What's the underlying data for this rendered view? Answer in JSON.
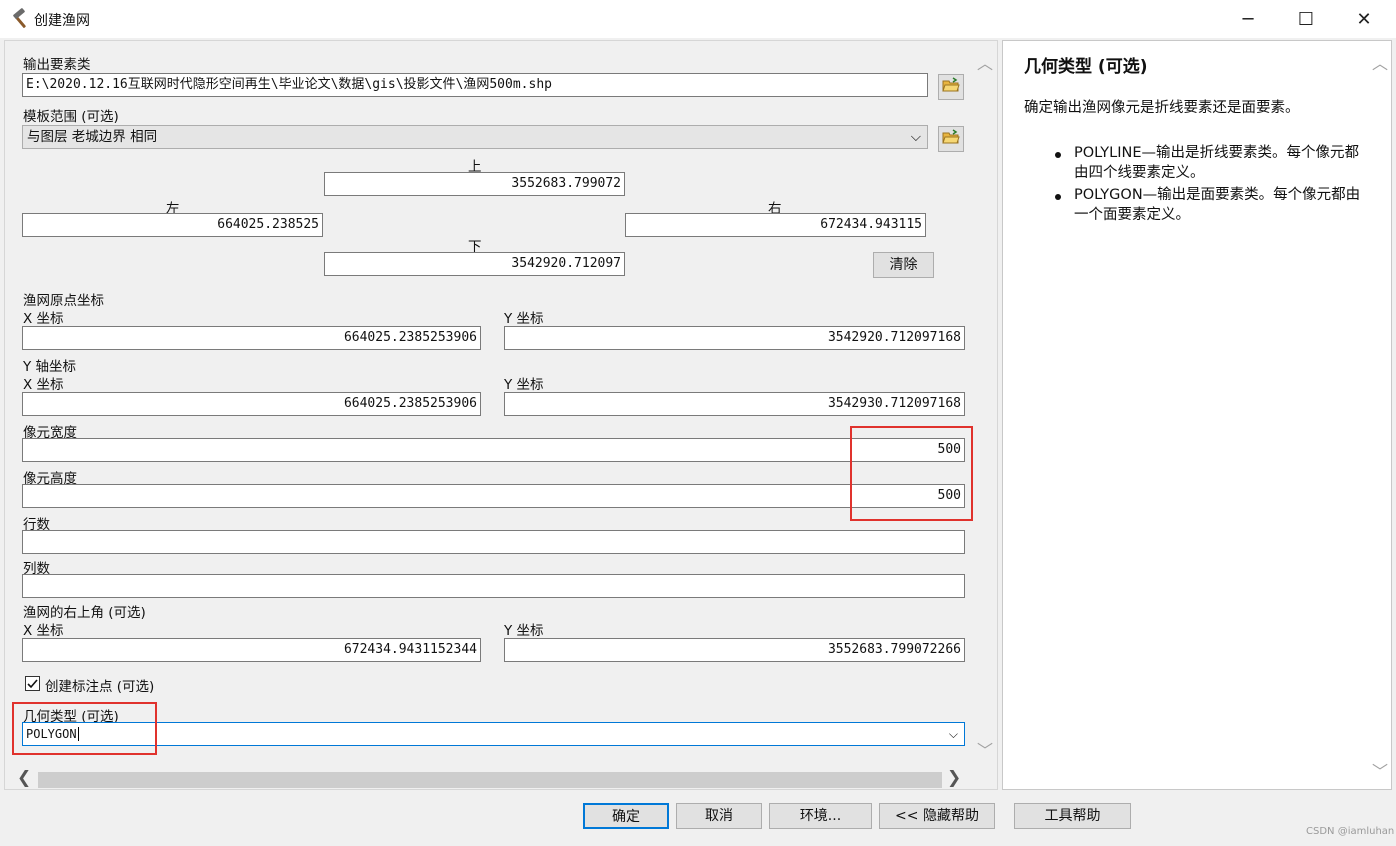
{
  "window": {
    "title": "创建渔网",
    "minimize": "─",
    "maximize": "☐",
    "close": "✕"
  },
  "form": {
    "output_label": "输出要素类",
    "output_value": "E:\\2020.12.16互联网时代隐形空间再生\\毕业论文\\数据\\gis\\投影文件\\渔网500m.shp",
    "template_label": "模板范围 (可选)",
    "template_value": "与图层 老城边界 相同",
    "top_label": "上",
    "top_value": "3552683.799072",
    "left_label": "左",
    "left_value": "664025.238525",
    "right_label": "右",
    "right_value": "672434.943115",
    "bottom_label": "下",
    "bottom_value": "3542920.712097",
    "clear_label": "清除",
    "origin_label": "渔网原点坐标",
    "origin_x_label": "X 坐标",
    "origin_x_value": "664025.2385253906",
    "origin_y_label": "Y 坐标",
    "origin_y_value": "3542920.712097168",
    "yaxis_label": "Y 轴坐标",
    "yaxis_x_label": "X 坐标",
    "yaxis_x_value": "664025.2385253906",
    "yaxis_y_label": "Y 坐标",
    "yaxis_y_value": "3542930.712097168",
    "cell_width_label": "像元宽度",
    "cell_width_value": "500",
    "cell_height_label": "像元高度",
    "cell_height_value": "500",
    "rows_label": "行数",
    "rows_value": "",
    "cols_label": "列数",
    "cols_value": "",
    "corner_label": "渔网的右上角 (可选)",
    "corner_x_label": "X 坐标",
    "corner_x_value": "672434.9431152344",
    "corner_y_label": "Y 坐标",
    "corner_y_value": "3552683.799072266",
    "labels_checkbox_label": "创建标注点 (可选)",
    "labels_checked": true,
    "geometry_label": "几何类型 (可选)",
    "geometry_value": "POLYGON"
  },
  "help": {
    "title": "几何类型 (可选)",
    "description": "确定输出渔网像元是折线要素还是面要素。",
    "items": [
      "POLYLINE—输出是折线要素类。每个像元都由四个线要素定义。",
      "POLYGON—输出是面要素类。每个像元都由一个面要素定义。"
    ]
  },
  "buttons": {
    "ok": "确定",
    "cancel": "取消",
    "env": "环境...",
    "hide_help": "<< 隐藏帮助",
    "tool_help": "工具帮助"
  },
  "watermark": "CSDN @iamluhan",
  "colors": {
    "highlight_box": "#e0322d",
    "focus_border": "#0078d7"
  },
  "icons": [
    "hammer-icon",
    "folder-open-icon",
    "chevron-down-icon",
    "chevron-up-icon",
    "chevron-left-icon",
    "chevron-right-icon",
    "checkbox-checked-icon"
  ]
}
